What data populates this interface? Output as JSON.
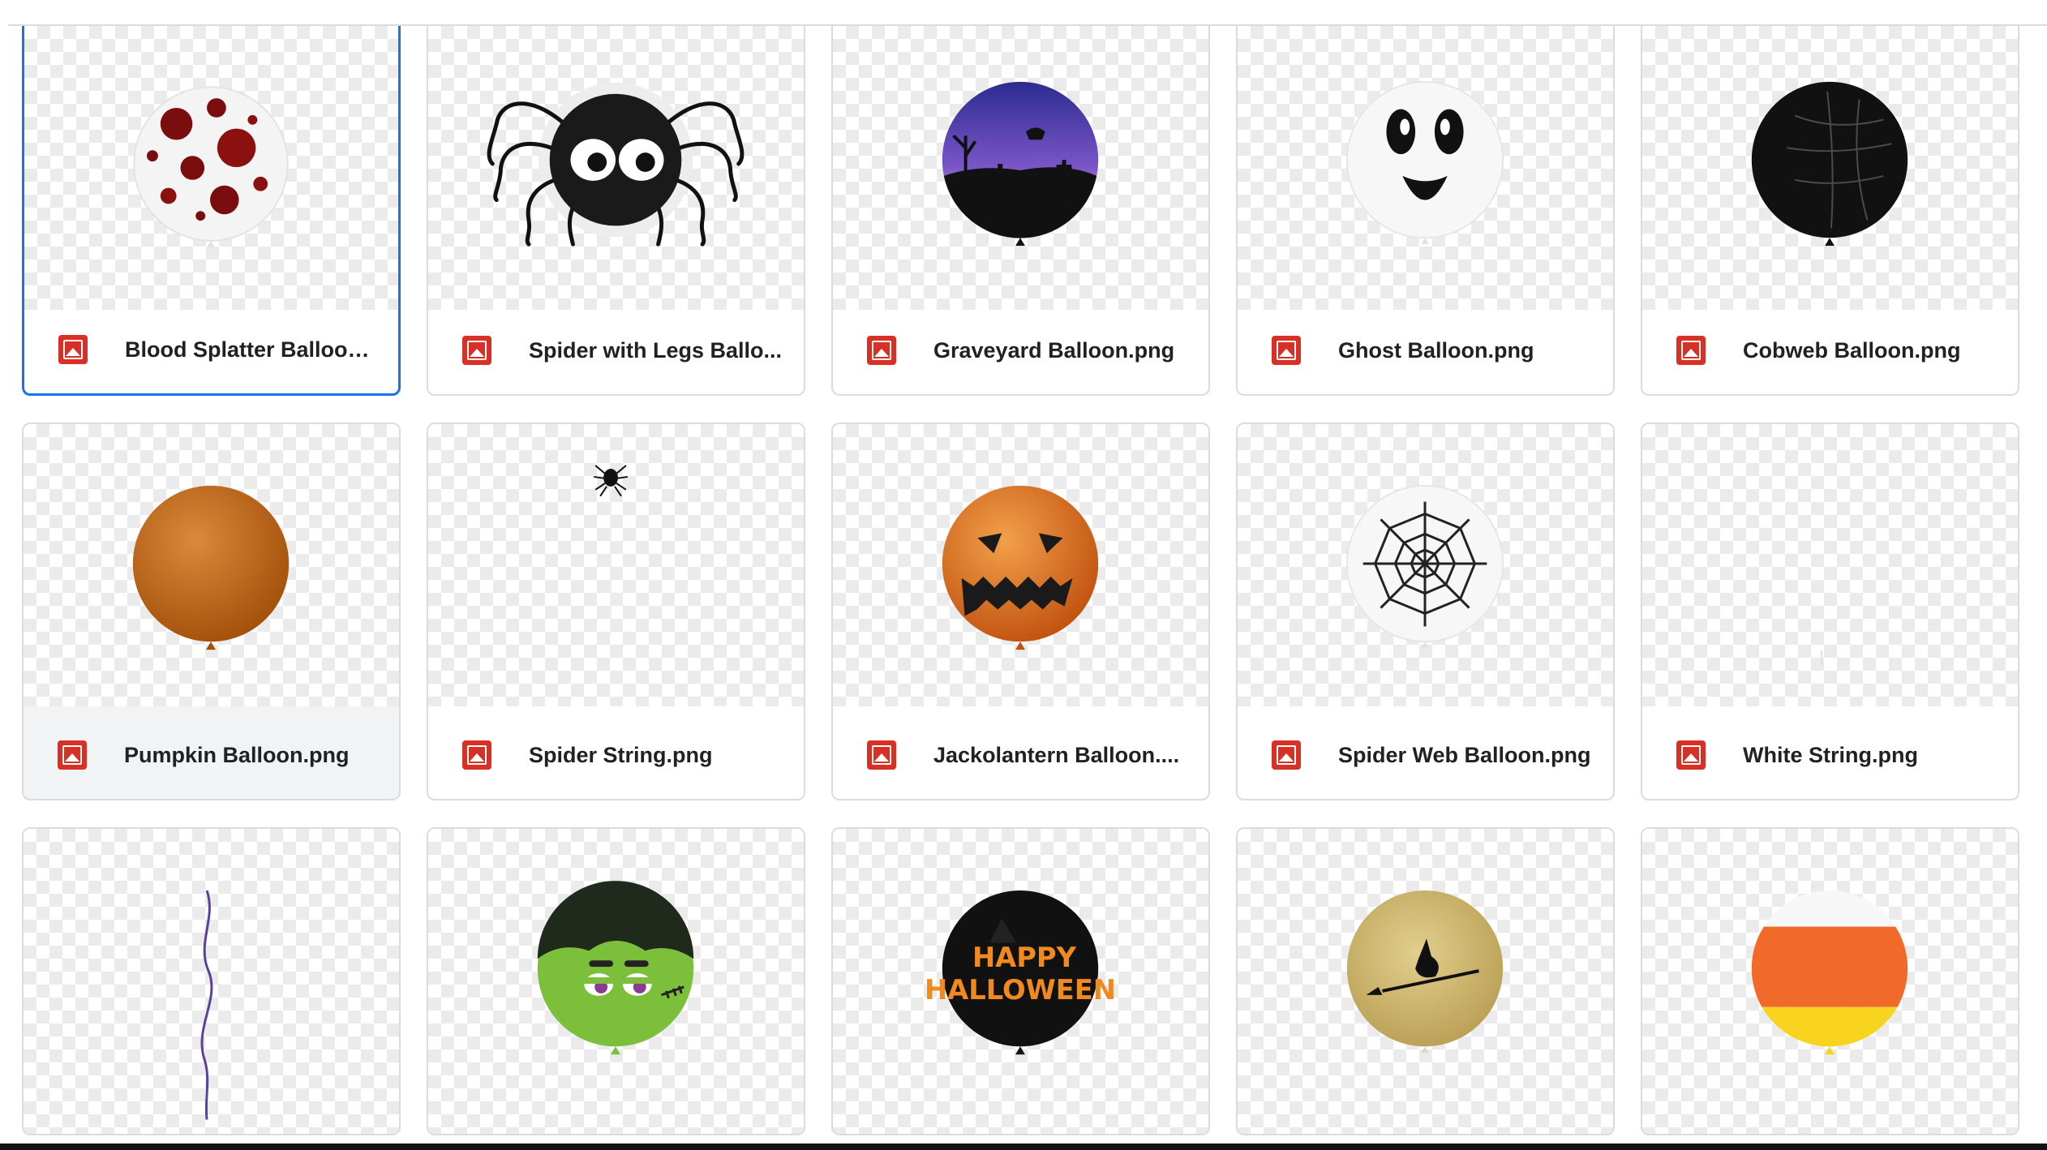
{
  "files": [
    {
      "name": "Blood Splatter Balloon....",
      "icon": "image-file-icon"
    },
    {
      "name": "Spider with Legs Ballo...",
      "icon": "image-file-icon"
    },
    {
      "name": "Graveyard Balloon.png",
      "icon": "image-file-icon"
    },
    {
      "name": "Ghost Balloon.png",
      "icon": "image-file-icon"
    },
    {
      "name": "Cobweb Balloon.png",
      "icon": "image-file-icon"
    },
    {
      "name": "Pumpkin Balloon.png",
      "icon": "image-file-icon"
    },
    {
      "name": "Spider String.png",
      "icon": "image-file-icon"
    },
    {
      "name": "Jackolantern Balloon....",
      "icon": "image-file-icon"
    },
    {
      "name": "Spider Web Balloon.png",
      "icon": "image-file-icon"
    },
    {
      "name": "White String.png",
      "icon": "image-file-icon"
    }
  ],
  "thumbnail_text": {
    "happy": "HAPPY",
    "halloween": "HALLOWEEN"
  },
  "colors": {
    "selected_border": "#1a73e8",
    "image_icon": "#d93025",
    "card_border": "#dadce0"
  }
}
